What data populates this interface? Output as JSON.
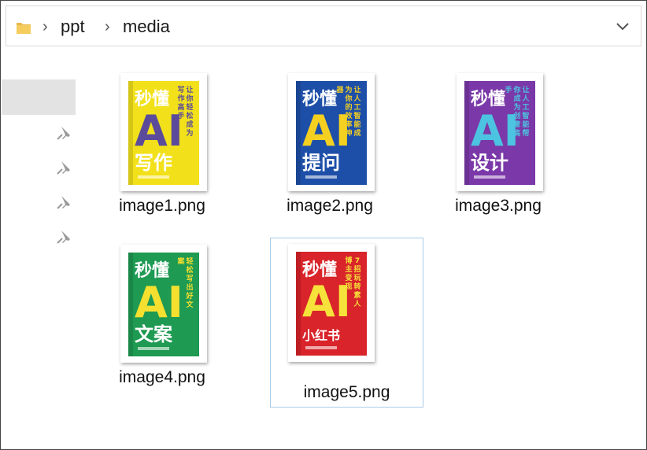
{
  "breadcrumb": {
    "segments": [
      "ppt",
      "media"
    ],
    "separator": "›"
  },
  "icons": {
    "folder": "folder-icon",
    "chevron": "chevron-right-icon",
    "dropdown": "chevron-down-icon",
    "pin": "pin-icon"
  },
  "files": [
    {
      "name": "image1.png",
      "cover": {
        "bg": "#f2e11a",
        "accent": "#5b4b9a",
        "title": "秒懂",
        "big": "AI",
        "sub": "写作",
        "tag": "让你轻松成为写作高手"
      }
    },
    {
      "name": "image2.png",
      "cover": {
        "bg": "#1e4fa8",
        "accent": "#f5d020",
        "title": "秒懂",
        "big": "AI",
        "sub": "提问",
        "tag": "让人工智能成为你的效率神器"
      }
    },
    {
      "name": "image3.png",
      "cover": {
        "bg": "#7a38a8",
        "accent": "#4cc3e0",
        "title": "秒懂",
        "big": "AI",
        "sub": "设计",
        "tag": "让人工智能帮你成为创意高手"
      }
    },
    {
      "name": "image4.png",
      "cover": {
        "bg": "#1e9a52",
        "accent": "#f5e030",
        "title": "秒懂",
        "big": "AI",
        "sub": "文案",
        "tag": "轻松写出好文案"
      }
    },
    {
      "name": "image5.png",
      "cover": {
        "bg": "#d8242a",
        "accent": "#f6e23a",
        "title": "秒懂",
        "big": "AI",
        "sub": "小红书",
        "tag": "7招玩转素人博主变现"
      }
    }
  ],
  "selected_index": 4
}
